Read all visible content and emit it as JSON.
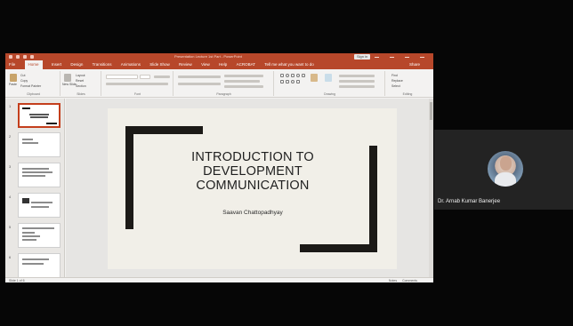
{
  "window": {
    "title": "Presentation Lecture 1st Part - PowerPoint",
    "signin": "Sign in"
  },
  "tabs": [
    "File",
    "Home",
    "Insert",
    "Design",
    "Transitions",
    "Animations",
    "Slide Show",
    "Review",
    "View",
    "Help",
    "ACROBAT",
    "Tell me what you want to do"
  ],
  "share_label": "Share",
  "ribbon": {
    "groups": [
      "Clipboard",
      "Slides",
      "Font",
      "Paragraph",
      "Drawing",
      "Editing"
    ],
    "clipboard": {
      "paste": "Paste",
      "cut": "Cut",
      "copy": "Copy",
      "format_painter": "Format Painter"
    },
    "slides": {
      "new_slide": "New Slide",
      "layout": "Layout",
      "reset": "Reset",
      "section": "Section"
    },
    "editing": {
      "find": "Find",
      "replace": "Replace",
      "select": "Select"
    }
  },
  "slide": {
    "title_lines": [
      "INTRODUCTION TO",
      "DEVELOPMENT",
      "COMMUNICATION"
    ],
    "author": "Saavan Chattopadhyay"
  },
  "thumbnails": [
    1,
    2,
    3,
    4,
    5,
    6
  ],
  "statusbar": {
    "slide_info": "Slide 1 of 6",
    "notes": "Notes",
    "comments": "Comments"
  },
  "participant": {
    "name": "Dr. Arnab Kumar Banerjee"
  },
  "colors": {
    "powerpoint_accent": "#b7472a",
    "selected_thumbnail": "#c43e1c",
    "slide_background": "#f1efe8",
    "slide_bars": "#1c1a17"
  }
}
